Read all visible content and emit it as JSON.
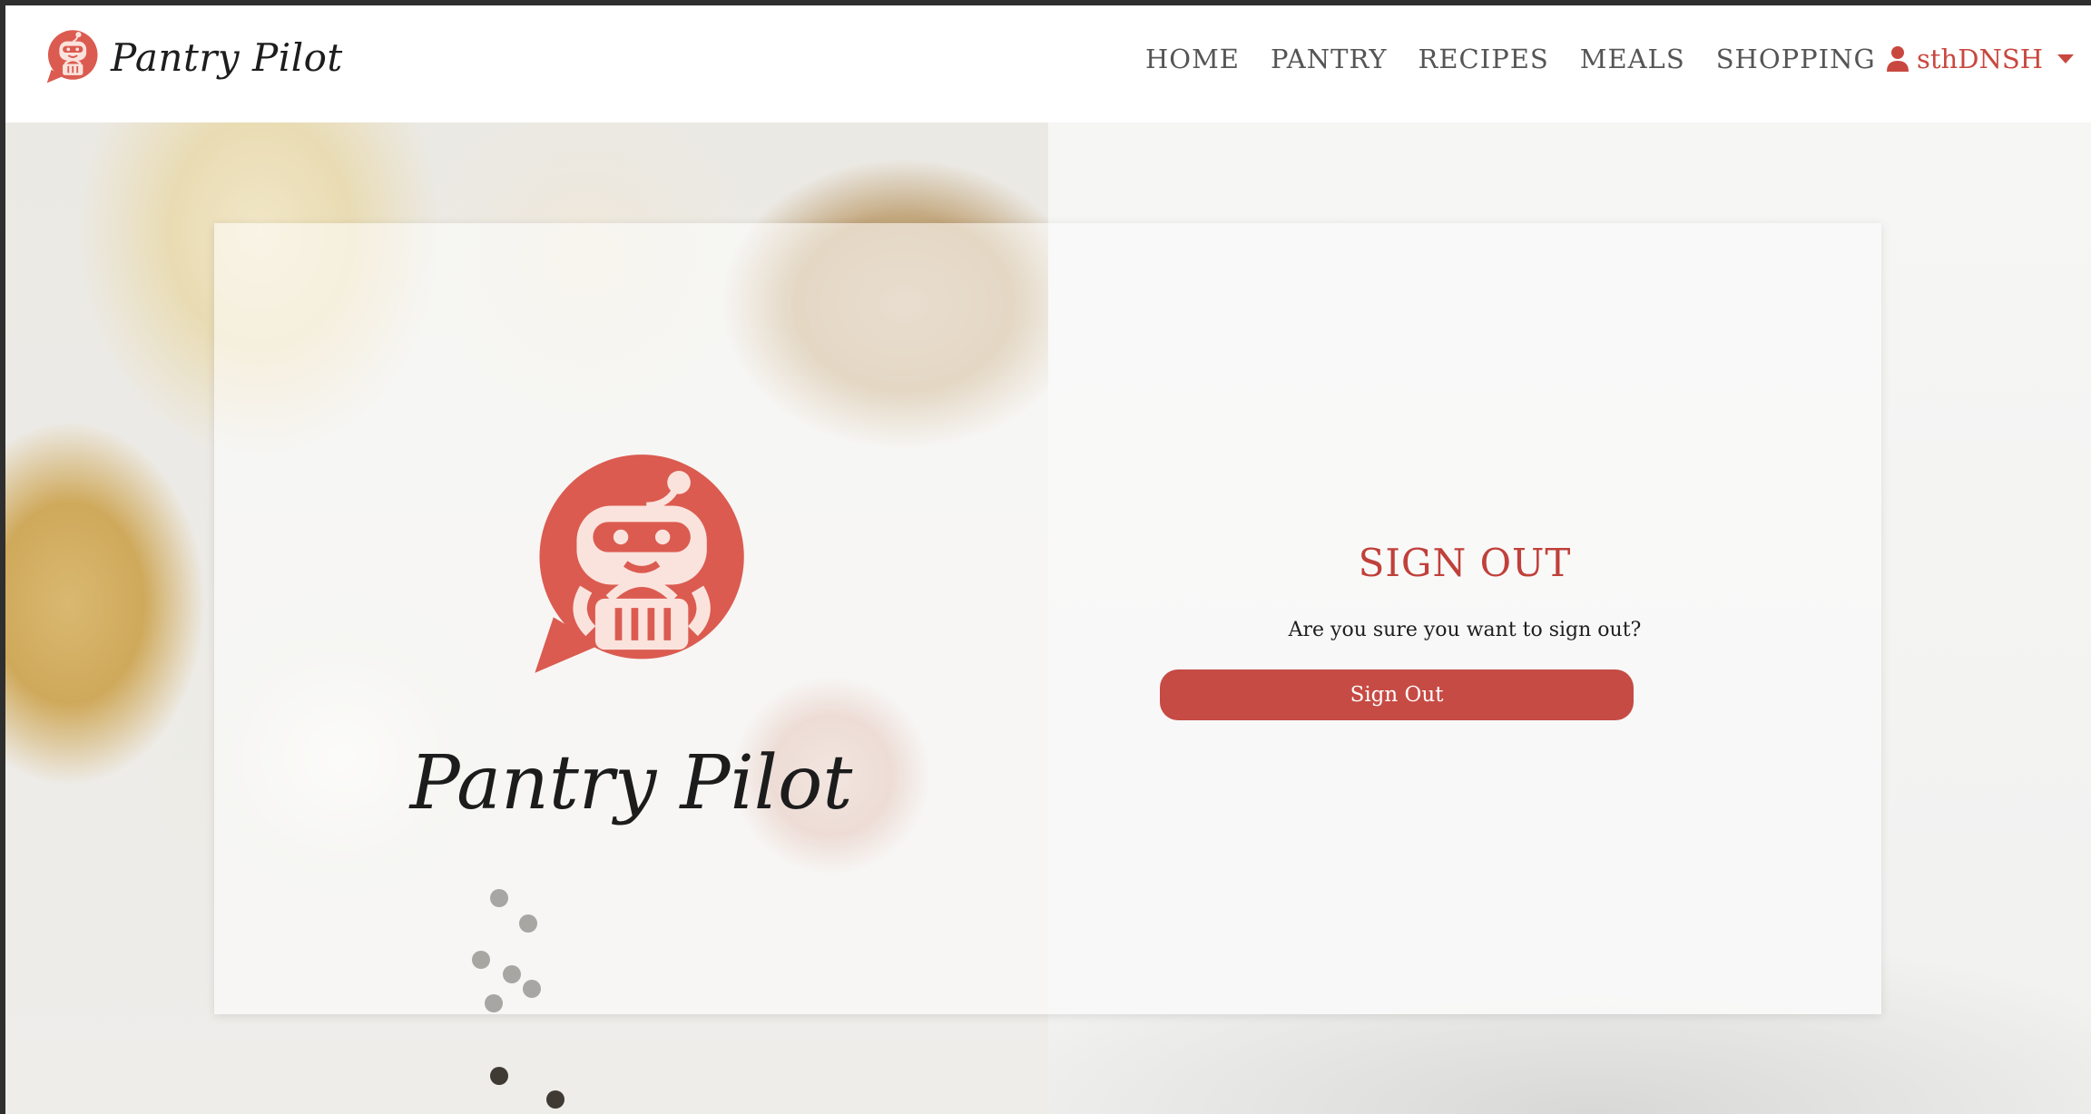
{
  "navbar": {
    "brand_text": "Pantry Pilot",
    "links": [
      "HOME",
      "PANTRY",
      "RECIPES",
      "MEALS",
      "SHOPPING"
    ],
    "user": "sthDNSH"
  },
  "hero": {
    "brand_text": "Pantry Pilot"
  },
  "signout": {
    "title": "SIGN OUT",
    "message": "Are you sure you want to sign out?",
    "button_label": "Sign Out"
  },
  "colors": {
    "brand_red": "#db5b50",
    "accent_red": "#c64b44",
    "title_red": "#c0403a"
  },
  "icons": {
    "brand": "robot-basket-logo-icon",
    "user": "user-icon",
    "dropdown": "caret-down-icon"
  }
}
